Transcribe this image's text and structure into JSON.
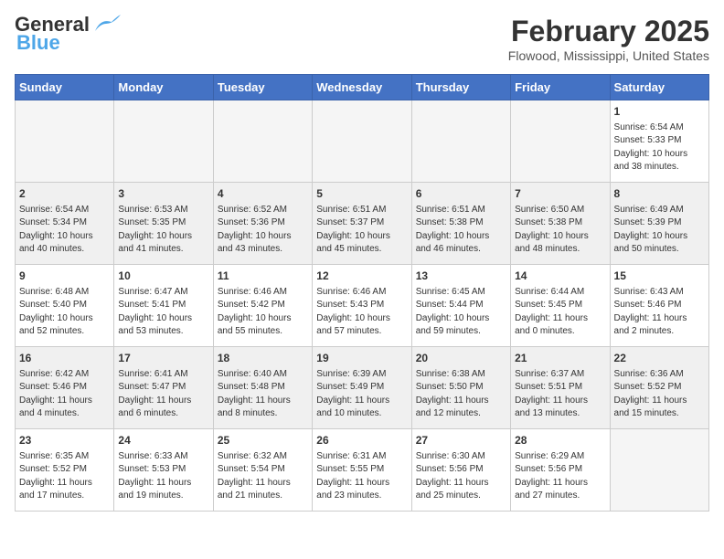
{
  "logo": {
    "line1": "General",
    "line2": "Blue"
  },
  "title": "February 2025",
  "location": "Flowood, Mississippi, United States",
  "days_of_week": [
    "Sunday",
    "Monday",
    "Tuesday",
    "Wednesday",
    "Thursday",
    "Friday",
    "Saturday"
  ],
  "weeks": [
    [
      {
        "day": "",
        "info": ""
      },
      {
        "day": "",
        "info": ""
      },
      {
        "day": "",
        "info": ""
      },
      {
        "day": "",
        "info": ""
      },
      {
        "day": "",
        "info": ""
      },
      {
        "day": "",
        "info": ""
      },
      {
        "day": "1",
        "info": "Sunrise: 6:54 AM\nSunset: 5:33 PM\nDaylight: 10 hours\nand 38 minutes."
      }
    ],
    [
      {
        "day": "2",
        "info": "Sunrise: 6:54 AM\nSunset: 5:34 PM\nDaylight: 10 hours\nand 40 minutes."
      },
      {
        "day": "3",
        "info": "Sunrise: 6:53 AM\nSunset: 5:35 PM\nDaylight: 10 hours\nand 41 minutes."
      },
      {
        "day": "4",
        "info": "Sunrise: 6:52 AM\nSunset: 5:36 PM\nDaylight: 10 hours\nand 43 minutes."
      },
      {
        "day": "5",
        "info": "Sunrise: 6:51 AM\nSunset: 5:37 PM\nDaylight: 10 hours\nand 45 minutes."
      },
      {
        "day": "6",
        "info": "Sunrise: 6:51 AM\nSunset: 5:38 PM\nDaylight: 10 hours\nand 46 minutes."
      },
      {
        "day": "7",
        "info": "Sunrise: 6:50 AM\nSunset: 5:38 PM\nDaylight: 10 hours\nand 48 minutes."
      },
      {
        "day": "8",
        "info": "Sunrise: 6:49 AM\nSunset: 5:39 PM\nDaylight: 10 hours\nand 50 minutes."
      }
    ],
    [
      {
        "day": "9",
        "info": "Sunrise: 6:48 AM\nSunset: 5:40 PM\nDaylight: 10 hours\nand 52 minutes."
      },
      {
        "day": "10",
        "info": "Sunrise: 6:47 AM\nSunset: 5:41 PM\nDaylight: 10 hours\nand 53 minutes."
      },
      {
        "day": "11",
        "info": "Sunrise: 6:46 AM\nSunset: 5:42 PM\nDaylight: 10 hours\nand 55 minutes."
      },
      {
        "day": "12",
        "info": "Sunrise: 6:46 AM\nSunset: 5:43 PM\nDaylight: 10 hours\nand 57 minutes."
      },
      {
        "day": "13",
        "info": "Sunrise: 6:45 AM\nSunset: 5:44 PM\nDaylight: 10 hours\nand 59 minutes."
      },
      {
        "day": "14",
        "info": "Sunrise: 6:44 AM\nSunset: 5:45 PM\nDaylight: 11 hours\nand 0 minutes."
      },
      {
        "day": "15",
        "info": "Sunrise: 6:43 AM\nSunset: 5:46 PM\nDaylight: 11 hours\nand 2 minutes."
      }
    ],
    [
      {
        "day": "16",
        "info": "Sunrise: 6:42 AM\nSunset: 5:46 PM\nDaylight: 11 hours\nand 4 minutes."
      },
      {
        "day": "17",
        "info": "Sunrise: 6:41 AM\nSunset: 5:47 PM\nDaylight: 11 hours\nand 6 minutes."
      },
      {
        "day": "18",
        "info": "Sunrise: 6:40 AM\nSunset: 5:48 PM\nDaylight: 11 hours\nand 8 minutes."
      },
      {
        "day": "19",
        "info": "Sunrise: 6:39 AM\nSunset: 5:49 PM\nDaylight: 11 hours\nand 10 minutes."
      },
      {
        "day": "20",
        "info": "Sunrise: 6:38 AM\nSunset: 5:50 PM\nDaylight: 11 hours\nand 12 minutes."
      },
      {
        "day": "21",
        "info": "Sunrise: 6:37 AM\nSunset: 5:51 PM\nDaylight: 11 hours\nand 13 minutes."
      },
      {
        "day": "22",
        "info": "Sunrise: 6:36 AM\nSunset: 5:52 PM\nDaylight: 11 hours\nand 15 minutes."
      }
    ],
    [
      {
        "day": "23",
        "info": "Sunrise: 6:35 AM\nSunset: 5:52 PM\nDaylight: 11 hours\nand 17 minutes."
      },
      {
        "day": "24",
        "info": "Sunrise: 6:33 AM\nSunset: 5:53 PM\nDaylight: 11 hours\nand 19 minutes."
      },
      {
        "day": "25",
        "info": "Sunrise: 6:32 AM\nSunset: 5:54 PM\nDaylight: 11 hours\nand 21 minutes."
      },
      {
        "day": "26",
        "info": "Sunrise: 6:31 AM\nSunset: 5:55 PM\nDaylight: 11 hours\nand 23 minutes."
      },
      {
        "day": "27",
        "info": "Sunrise: 6:30 AM\nSunset: 5:56 PM\nDaylight: 11 hours\nand 25 minutes."
      },
      {
        "day": "28",
        "info": "Sunrise: 6:29 AM\nSunset: 5:56 PM\nDaylight: 11 hours\nand 27 minutes."
      },
      {
        "day": "",
        "info": ""
      }
    ]
  ]
}
